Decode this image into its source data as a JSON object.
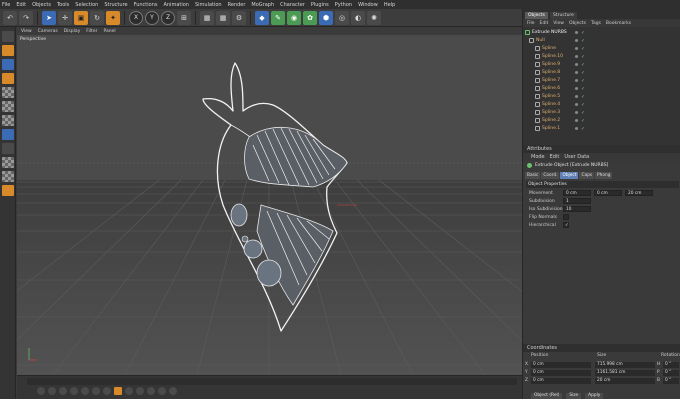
{
  "menu": [
    "File",
    "Edit",
    "Objects",
    "Tools",
    "Selection",
    "Structure",
    "Functions",
    "Animation",
    "Simulation",
    "Render",
    "MoGraph",
    "Character",
    "Plugins",
    "Python",
    "Window",
    "Help"
  ],
  "toolbar": {
    "axis_x": "X",
    "axis_y": "Y",
    "axis_z": "Z"
  },
  "viewport": {
    "menu": [
      "View",
      "Cameras",
      "Display",
      "Filter",
      "Panel"
    ],
    "label": "Perspective"
  },
  "right_tabs": [
    "Objects",
    "Structure"
  ],
  "object_manager": {
    "menu": [
      "File",
      "Edit",
      "View",
      "Objects",
      "Tags",
      "Bookmarks"
    ],
    "items": [
      {
        "name": "Extrude NURBS",
        "white": true
      },
      {
        "name": "Null",
        "white": false
      },
      {
        "name": "Spline",
        "white": false
      },
      {
        "name": "Spline.10",
        "white": false
      },
      {
        "name": "Spline.9",
        "white": false
      },
      {
        "name": "Spline.8",
        "white": false
      },
      {
        "name": "Spline.7",
        "white": false
      },
      {
        "name": "Spline.6",
        "white": false
      },
      {
        "name": "Spline.5",
        "white": false
      },
      {
        "name": "Spline.4",
        "white": false
      },
      {
        "name": "Spline.3",
        "white": false
      },
      {
        "name": "Spline.2",
        "white": false
      },
      {
        "name": "Spline.1",
        "white": false
      }
    ]
  },
  "attributes": {
    "header": "Attributes",
    "menu": [
      "Mode",
      "Edit",
      "User Data"
    ],
    "title": "Extrude Object [Extrude NURBS]",
    "tabs": [
      {
        "label": "Basic",
        "active": false
      },
      {
        "label": "Coord.",
        "active": false
      },
      {
        "label": "Object",
        "active": true
      },
      {
        "label": "Caps",
        "active": false
      },
      {
        "label": "Phong",
        "active": false
      }
    ],
    "section": "Object Properties",
    "props": [
      {
        "label": "Movement",
        "values": [
          "0 cm",
          "0 cm",
          "20 cm"
        ]
      },
      {
        "label": "Subdivision",
        "values": [
          "1"
        ]
      },
      {
        "label": "Iso Subdivision",
        "values": [
          "10"
        ]
      },
      {
        "label": "Flip Normals",
        "values": []
      },
      {
        "label": "Hierarchical",
        "values": []
      }
    ]
  },
  "coordinates": {
    "header": "Coordinates",
    "col_position": "Position",
    "col_size": "Size",
    "col_rotation": "Rotation",
    "rows": [
      {
        "axis": "X",
        "pos": "0 cm",
        "size": "715.998 cm",
        "rot_axis": "H",
        "rot": "0 °"
      },
      {
        "axis": "Y",
        "pos": "0 cm",
        "size": "1161.581 cm",
        "rot_axis": "P",
        "rot": "0 °"
      },
      {
        "axis": "Z",
        "pos": "0 cm",
        "size": "20 cm",
        "rot_axis": "B",
        "rot": "0 °"
      }
    ],
    "mode": "Object (Rel)",
    "size_mode": "Size",
    "apply": "Apply"
  }
}
